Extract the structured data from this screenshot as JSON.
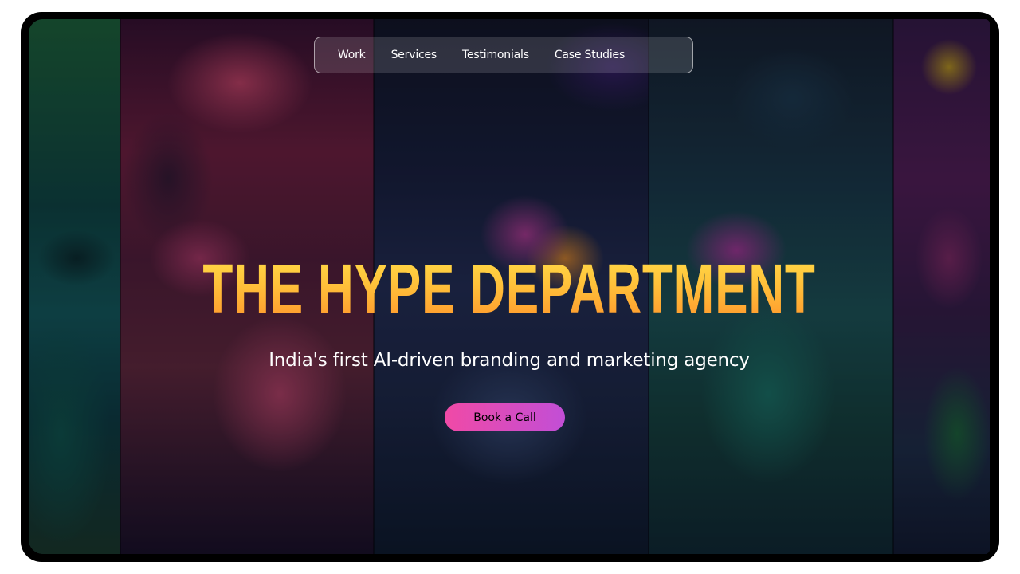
{
  "nav": {
    "items": [
      {
        "label": "Work"
      },
      {
        "label": "Services"
      },
      {
        "label": "Testimonials"
      },
      {
        "label": "Case Studies"
      }
    ]
  },
  "hero": {
    "headline": "THE HYPE DEPARTMENT",
    "tagline": "India's first AI-driven branding and marketing agency",
    "cta_label": "Book a Call"
  },
  "colors": {
    "headline_top": "#ffe14a",
    "headline_bottom": "#ff8f2a",
    "cta_start": "#f04aa6",
    "cta_end": "#c24ed6",
    "frame": "#000000"
  }
}
